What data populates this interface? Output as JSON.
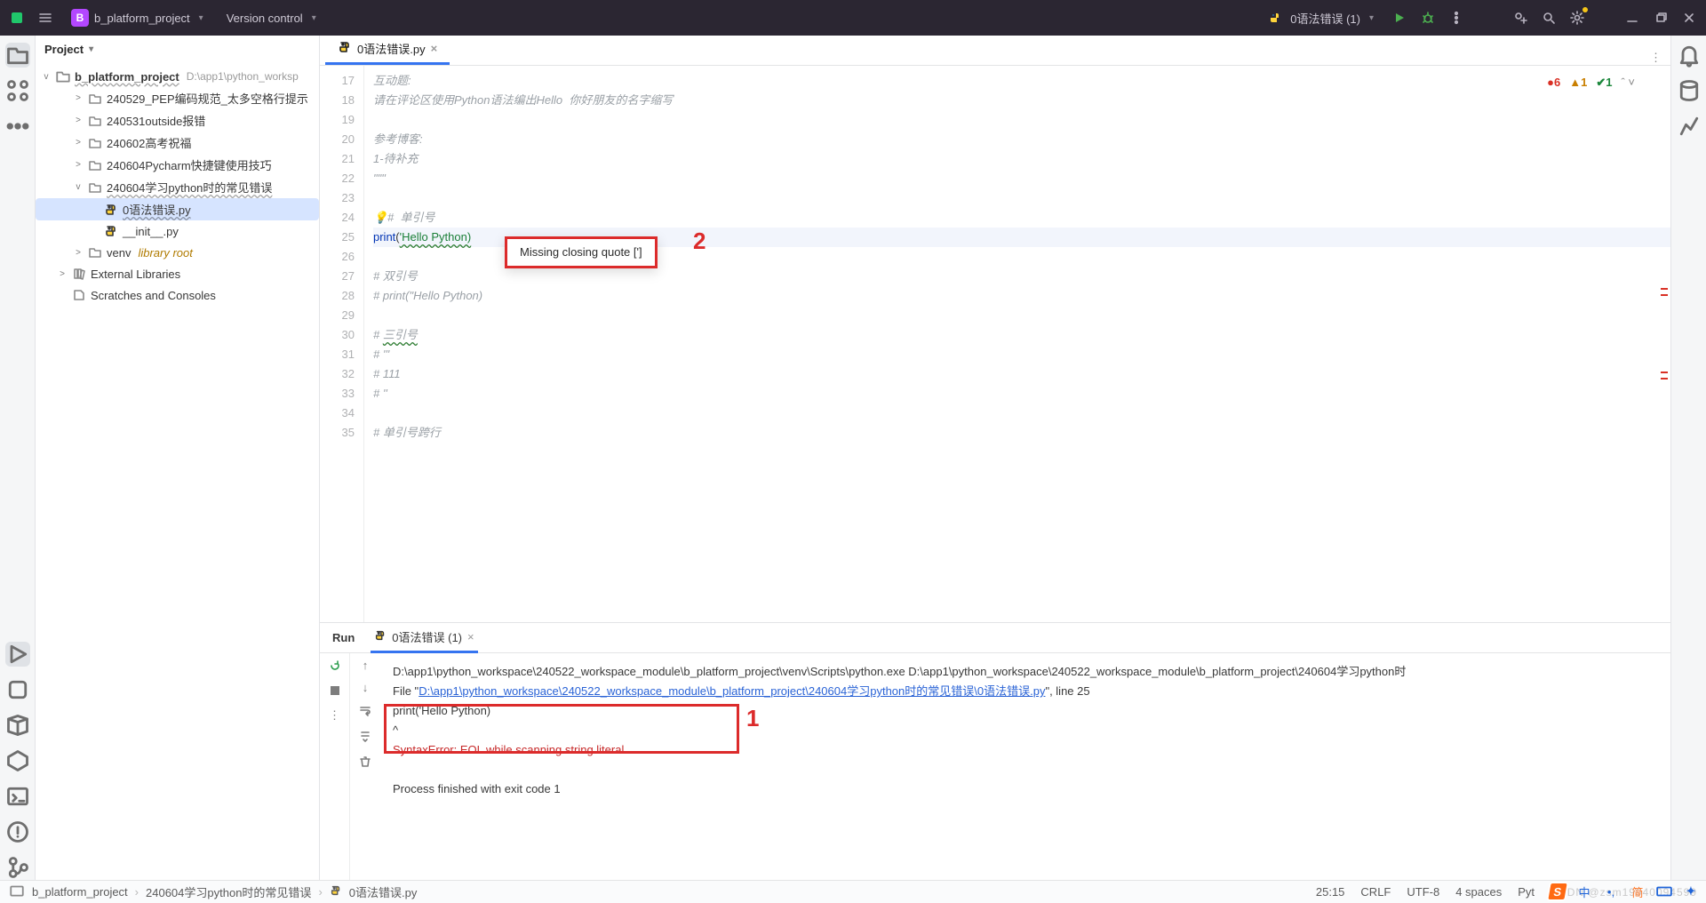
{
  "titlebar": {
    "project_initial": "B",
    "project_name": "b_platform_project",
    "vcs": "Version control",
    "run_config": "0语法错误 (1)"
  },
  "projectPane": {
    "title": "Project",
    "root": {
      "name": "b_platform_project",
      "path": "D:\\app1\\python_worksp"
    },
    "nodes": [
      {
        "type": "dir",
        "label": "240529_PEP编码规范_太多空格行提示",
        "depth": 2,
        "tw": ">"
      },
      {
        "type": "dir",
        "label": "240531outside报错",
        "depth": 2,
        "tw": ">"
      },
      {
        "type": "dir",
        "label": "240602高考祝福",
        "depth": 2,
        "tw": ">"
      },
      {
        "type": "dir",
        "label": "240604Pycharm快捷键使用技巧",
        "depth": 2,
        "tw": ">"
      },
      {
        "type": "dir",
        "label": "240604学习python时的常见错误",
        "depth": 2,
        "tw": "v",
        "wavy": true
      },
      {
        "type": "py",
        "label": "0语法错误.py",
        "depth": 3,
        "sel": true,
        "wavy": true
      },
      {
        "type": "py",
        "label": "__init__.py",
        "depth": 3
      },
      {
        "type": "dir",
        "label": "venv",
        "lib": "library root",
        "depth": 2,
        "tw": ">"
      },
      {
        "type": "lib",
        "label": "External Libraries",
        "depth": 1,
        "tw": ">"
      },
      {
        "type": "scratch",
        "label": "Scratches and Consoles",
        "depth": 1
      }
    ]
  },
  "editor": {
    "tab": "0语法错误.py",
    "insp": {
      "err": "6",
      "warn": "1",
      "ok": "1"
    },
    "startLine": 17,
    "lines": [
      {
        "n": 17,
        "cls": "c-comment",
        "t": "互动题:"
      },
      {
        "n": 18,
        "cls": "c-comment",
        "t": "请在评论区使用Python语法编出Hello  你好朋友的名字缩写"
      },
      {
        "n": 19,
        "cls": "c-comment",
        "t": ""
      },
      {
        "n": 20,
        "cls": "c-comment",
        "t": "参考博客:"
      },
      {
        "n": 21,
        "cls": "c-comment",
        "t": "1-待补充"
      },
      {
        "n": 22,
        "cls": "c-comment",
        "t": "\"\"\""
      },
      {
        "n": 23,
        "t": ""
      },
      {
        "n": 24,
        "bulb": true,
        "cls": "c-comment",
        "t": "#  单引号"
      },
      {
        "n": 25,
        "hl": true,
        "html": "<span class='c-func'>print</span>(<span class='c-str err-green'>'Hello Python)</span>"
      },
      {
        "n": 26,
        "t": ""
      },
      {
        "n": 27,
        "cls": "c-comment",
        "t": "# 双引号"
      },
      {
        "n": 28,
        "cls": "c-comment",
        "t": "# print(\"Hello Python)"
      },
      {
        "n": 29,
        "t": ""
      },
      {
        "n": 30,
        "cls": "c-comment",
        "html": "# <span class='err-green'>三引号</span>"
      },
      {
        "n": 31,
        "cls": "c-comment",
        "t": "# '''"
      },
      {
        "n": 32,
        "cls": "c-comment",
        "t": "# 111"
      },
      {
        "n": 33,
        "cls": "c-comment",
        "t": "# ''"
      },
      {
        "n": 34,
        "t": ""
      },
      {
        "n": 35,
        "cls": "c-comment",
        "t": "# 单引号跨行"
      }
    ],
    "tooltip": "Missing closing quote [']",
    "annotation": "2"
  },
  "run": {
    "label": "Run",
    "tab": "0语法错误 (1)",
    "cmd": "D:\\app1\\python_workspace\\240522_workspace_module\\b_platform_project\\venv\\Scripts\\python.exe D:\\app1\\python_workspace\\240522_workspace_module\\b_platform_project\\240604学习python时",
    "file_pre": "  File \"",
    "file_link": "D:\\app1\\python_workspace\\240522_workspace_module\\b_platform_project\\240604学习python时的常见错误\\0语法错误.py",
    "file_post": "\", line 25",
    "codeline": "    print('Hello Python)",
    "caret": "                        ^",
    "error": "SyntaxError: EOL while scanning string literal",
    "exit": "Process finished with exit code 1",
    "annotation": "1"
  },
  "breadcrumb": [
    "b_platform_project",
    "240604学习python时的常见错误",
    "0语法错误.py"
  ],
  "status": {
    "pos": "25:15",
    "eol": "CRLF",
    "enc": "UTF-8",
    "indent": "4 spaces",
    "lang": "Pyt"
  },
  "watermark": "CSDN @zsm19940094599"
}
